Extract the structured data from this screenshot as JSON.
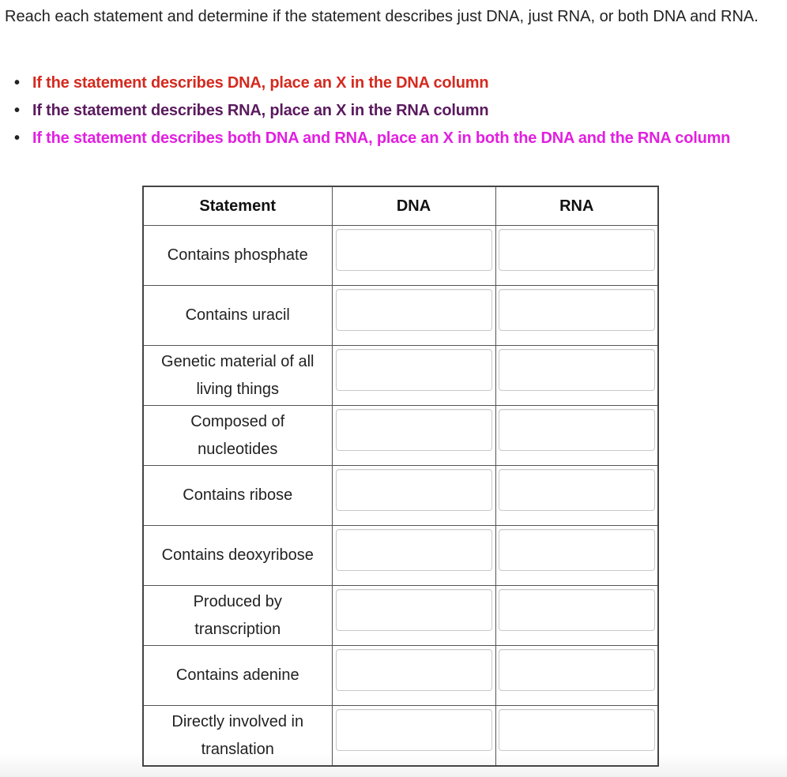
{
  "instructions": {
    "intro": "Reach each statement and determine if the statement describes just DNA, just RNA, or both DNA and RNA.",
    "rules": [
      {
        "text": "If the statement describes DNA, place an X in the DNA column",
        "color": "#d42a1f"
      },
      {
        "text": "If the statement describes RNA, place an X in the RNA column",
        "color": "#5a1a5e"
      },
      {
        "text": "If the statement describes both DNA and RNA, place an X in both the DNA and the RNA column",
        "color": "#e21fe0"
      }
    ]
  },
  "table": {
    "headers": [
      "Statement",
      "DNA",
      "RNA"
    ],
    "rows": [
      {
        "statement": "Contains phosphate",
        "dna": "",
        "rna": ""
      },
      {
        "statement": "Contains uracil",
        "dna": "",
        "rna": ""
      },
      {
        "statement": "Genetic material of all living things",
        "dna": "",
        "rna": ""
      },
      {
        "statement": "Composed of nucleotides",
        "dna": "",
        "rna": ""
      },
      {
        "statement": "Contains ribose",
        "dna": "",
        "rna": ""
      },
      {
        "statement": "Contains deoxyribose",
        "dna": "",
        "rna": ""
      },
      {
        "statement": "Produced by transcription",
        "dna": "",
        "rna": ""
      },
      {
        "statement": "Contains adenine",
        "dna": "",
        "rna": ""
      },
      {
        "statement": "Directly involved in translation",
        "dna": "",
        "rna": ""
      }
    ]
  }
}
